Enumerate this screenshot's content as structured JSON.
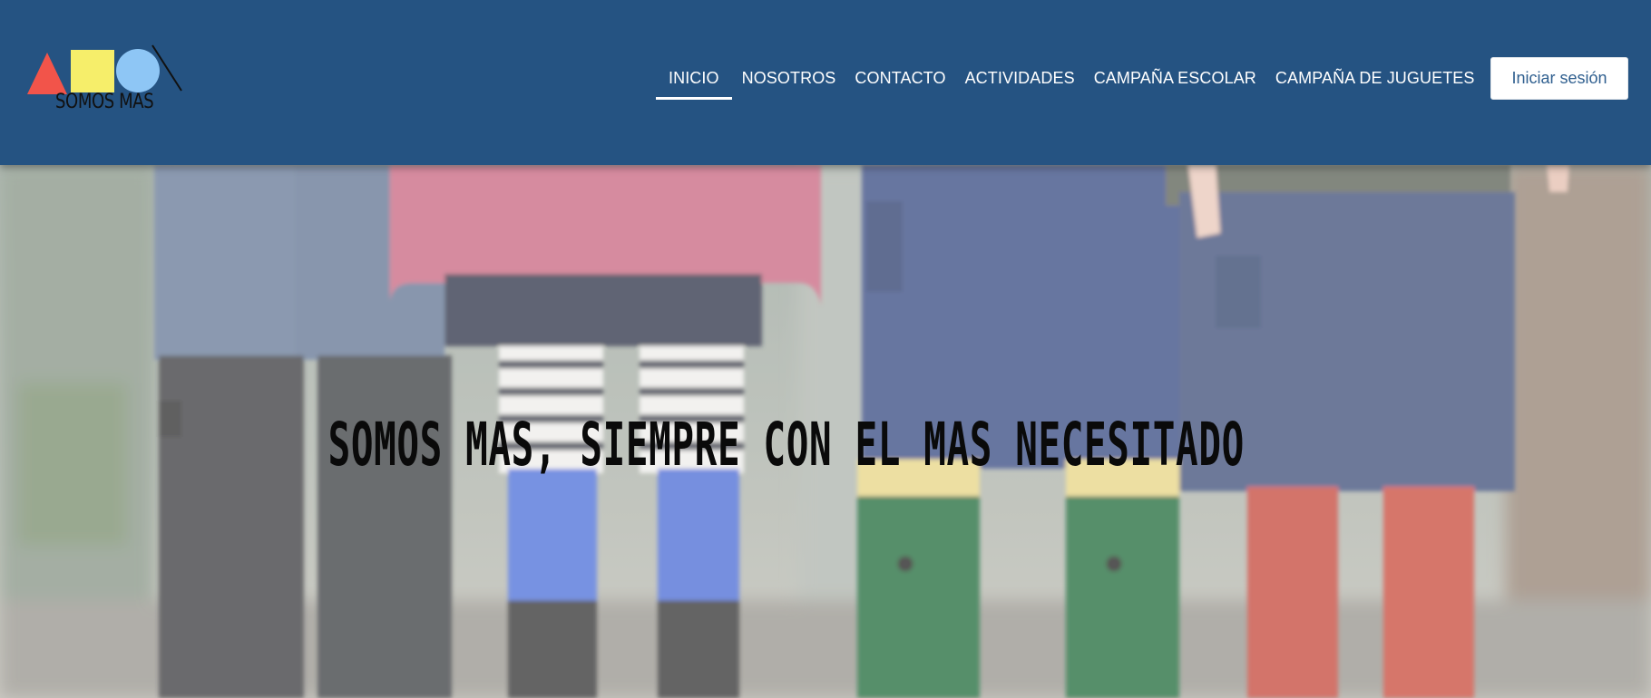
{
  "header": {
    "logo_text": "SOMOS MAS",
    "nav": [
      {
        "label": "INICIO",
        "active": true
      },
      {
        "label": "NOSOTROS",
        "active": false
      },
      {
        "label": "CONTACTO",
        "active": false
      },
      {
        "label": "ACTIVIDADES",
        "active": false
      },
      {
        "label": "CAMPAÑA ESCOLAR",
        "active": false
      },
      {
        "label": "CAMPAÑA DE JUGUETES",
        "active": false
      }
    ],
    "login_label": "Iniciar sesión",
    "background_color": "#255382"
  },
  "hero": {
    "title": "SOMOS MAS, SIEMPRE CON EL MAS NECESITADO",
    "image_subject": "children-legs-rain-boots-photo"
  },
  "colors": {
    "accent": "#255382",
    "logo_triangle": "#f2544a",
    "logo_square": "#f6ee6a",
    "logo_circle": "#8ec6f5"
  }
}
